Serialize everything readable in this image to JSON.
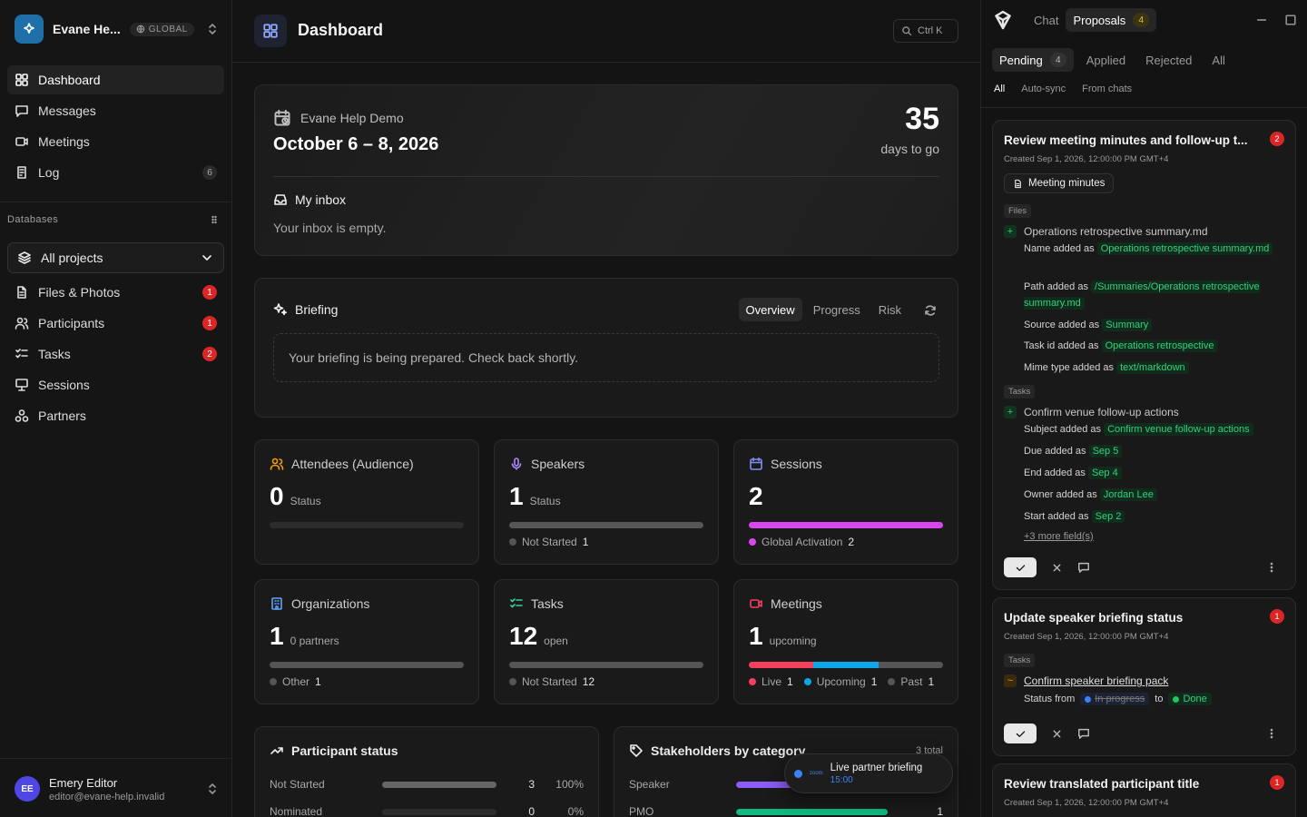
{
  "workspace": {
    "name": "Evane He...",
    "badge": "GLOBAL"
  },
  "nav": {
    "dashboard": "Dashboard",
    "messages": "Messages",
    "meetings": "Meetings",
    "log": "Log",
    "log_count": "6"
  },
  "databases": {
    "header": "Databases",
    "project_select": "All projects",
    "items": [
      {
        "label": "Files & Photos",
        "count": "1"
      },
      {
        "label": "Participants",
        "count": "1"
      },
      {
        "label": "Tasks",
        "count": "2"
      },
      {
        "label": "Sessions",
        "count": ""
      },
      {
        "label": "Partners",
        "count": ""
      }
    ]
  },
  "user": {
    "initials": "EE",
    "name": "Emery Editor",
    "email": "editor@evane-help.invalid"
  },
  "header": {
    "title": "Dashboard",
    "search_hint": "Ctrl K"
  },
  "hero": {
    "event_name": "Evane Help Demo",
    "dates": "October 6 – 8, 2026",
    "days": "35",
    "days_label": "days to go",
    "inbox_title": "My inbox",
    "inbox_empty": "Your inbox is empty."
  },
  "briefing": {
    "title": "Briefing",
    "tabs": [
      "Overview",
      "Progress",
      "Risk"
    ],
    "message": "Your briefing is being prepared. Check back shortly."
  },
  "stats": {
    "attendees": {
      "title": "Attendees (Audience)",
      "value": "0",
      "sub": "Status"
    },
    "speakers": {
      "title": "Speakers",
      "value": "1",
      "sub": "Status",
      "legend": "Not Started",
      "legend_count": "1"
    },
    "sessions": {
      "title": "Sessions",
      "value": "2",
      "sub": "",
      "legend": "Global Activation",
      "legend_count": "2"
    },
    "organizations": {
      "title": "Organizations",
      "value": "1",
      "sub": "0 partners",
      "legend": "Other",
      "legend_count": "1"
    },
    "tasks": {
      "title": "Tasks",
      "value": "12",
      "sub": "open",
      "legend": "Not Started",
      "legend_count": "12"
    },
    "meetings": {
      "title": "Meetings",
      "value": "1",
      "sub": "upcoming",
      "legend": [
        {
          "label": "Live",
          "count": "1"
        },
        {
          "label": "Upcoming",
          "count": "1"
        },
        {
          "label": "Past",
          "count": "1"
        }
      ]
    }
  },
  "participant_status": {
    "title": "Participant status",
    "rows": [
      {
        "label": "Not Started",
        "value": "3",
        "pct": "100%",
        "fraction": 1.0
      },
      {
        "label": "Nominated",
        "value": "0",
        "pct": "0%",
        "fraction": 0.0
      }
    ]
  },
  "stakeholders": {
    "title": "Stakeholders by category",
    "total": "3 total",
    "rows": [
      {
        "label": "Speaker",
        "value": "",
        "fraction": 0.4
      },
      {
        "label": "PMO",
        "value": "1",
        "fraction": 0.8
      }
    ]
  },
  "toast": {
    "title": "Live partner briefing",
    "time": "15:00",
    "brand": "zoom"
  },
  "rpanel": {
    "tab_chat": "Chat",
    "tab_proposals": "Proposals",
    "proposals_count": "4",
    "filters": [
      "Pending",
      "Applied",
      "Rejected",
      "All"
    ],
    "pending_count": "4",
    "sources": [
      "All",
      "Auto-sync",
      "From chats"
    ]
  },
  "proposals": [
    {
      "title": "Review meeting minutes and follow-up t...",
      "count": "2",
      "created": "Created Sep 1, 2026, 12:00:00 PM GMT+4",
      "chip": "Meeting minutes",
      "files_label": "Files",
      "file_name": "Operations retrospective summary.md",
      "file_fields": [
        {
          "k": "Name added as",
          "v": "Operations retrospective summary.md"
        },
        {
          "k": "Path added as",
          "v": "/Summaries/Operations retrospective summary.md"
        },
        {
          "k": "Source added as",
          "v": "Summary"
        },
        {
          "k": "Task id added as",
          "v": "Operations retrospective"
        },
        {
          "k": "Mime type added as",
          "v": "text/markdown"
        }
      ],
      "tasks_label": "Tasks",
      "task_name": "Confirm venue follow-up actions",
      "task_fields": [
        {
          "k": "Subject added as",
          "v": "Confirm venue follow-up actions"
        },
        {
          "k": "Due added as",
          "v": "Sep 5"
        },
        {
          "k": "End added as",
          "v": "Sep 4"
        },
        {
          "k": "Owner added as",
          "v": "Jordan Lee"
        },
        {
          "k": "Start added as",
          "v": "Sep 2"
        }
      ],
      "more": "+3 more field(s)"
    },
    {
      "title": "Update speaker briefing status",
      "count": "1",
      "created": "Created Sep 1, 2026, 12:00:00 PM GMT+4",
      "tasks_label": "Tasks",
      "task_name": "Confirm speaker briefing pack",
      "status_prefix": "Status from",
      "status_old": "In progress",
      "status_to": "to",
      "status_new": "Done"
    },
    {
      "title": "Review translated participant title",
      "count": "1",
      "created": "Created Sep 1, 2026, 12:00:00 PM GMT+4"
    }
  ],
  "colors": {
    "accent": "#3b82f6",
    "sessions_bar": "#d946ef",
    "live": "#f43f5e",
    "upcoming": "#0ea5e9",
    "past": "#555555",
    "stake_speaker": "#8b5cf6",
    "stake_pmo": "#10b981",
    "danger": "#dc2626"
  }
}
